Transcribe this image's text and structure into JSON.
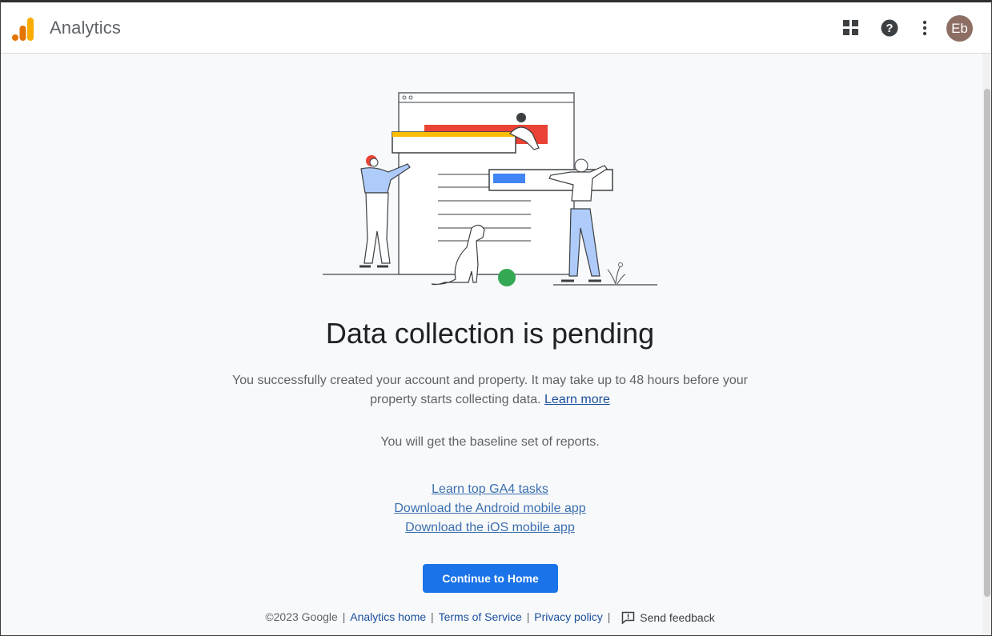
{
  "header": {
    "app_title": "Analytics",
    "avatar_initials": "Eb",
    "icons": [
      "apps-grid-icon",
      "help-icon",
      "more-vert-icon"
    ]
  },
  "main": {
    "title": "Data collection is pending",
    "description": "You successfully created your account and property. It may take up to 48 hours before your property starts collecting data.",
    "learn_more": "Learn more",
    "baseline_text": "You will get the baseline set of reports.",
    "links": [
      "Learn top GA4 tasks",
      "Download the Android mobile app",
      "Download the iOS mobile app"
    ],
    "cta_label": "Continue to Home"
  },
  "footer": {
    "copyright": "©2023 Google",
    "analytics_home": "Analytics home",
    "terms": "Terms of Service",
    "privacy": "Privacy policy",
    "feedback": "Send feedback"
  },
  "colors": {
    "brand_orange": "#f9ab00",
    "brand_dark_orange": "#e37400",
    "primary_blue": "#1a73e8",
    "link_blue": "#1a4f9c",
    "illustration_red": "#ea4335",
    "illustration_yellow": "#fbbc04",
    "illustration_green": "#34a853"
  }
}
